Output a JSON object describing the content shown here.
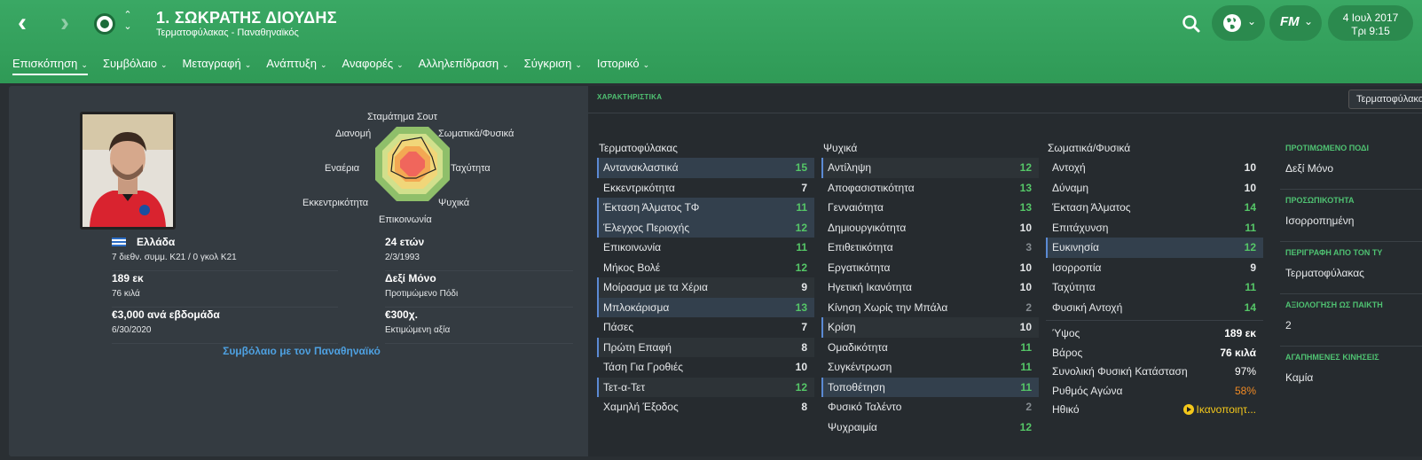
{
  "header": {
    "title": "1. ΣΩΚΡΑΤΗΣ ΔΙΟΥΔΗΣ",
    "subtitle": "Τερματοφύλακας - Παναθηναϊκός",
    "fm_label": "FM",
    "date": "4 Ιουλ 2017",
    "day_time": "Τρι 9:15",
    "back_icon": "chevron-left-icon",
    "forward_icon": "chevron-right-icon",
    "search_icon": "search-icon",
    "globe_icon": "globe-icon"
  },
  "tabs": [
    {
      "label": "Επισκόπηση",
      "active": true
    },
    {
      "label": "Συμβόλαιο"
    },
    {
      "label": "Μεταγραφή"
    },
    {
      "label": "Ανάπτυξη"
    },
    {
      "label": "Αναφορές"
    },
    {
      "label": "Αλληλεπίδραση"
    },
    {
      "label": "Σύγκριση"
    },
    {
      "label": "Ιστορικό"
    }
  ],
  "overview": {
    "radar_labels": {
      "top": "Σταμάτημα Σουτ",
      "top_left": "Διανομή",
      "top_right": "Σωματικά/Φυσικά",
      "left": "Εναέρια",
      "right": "Ταχύτητα",
      "bottom_left": "Εκκεντρικότητα",
      "bottom_right": "Ψυχικά",
      "bottom": "Επικοινωνία"
    },
    "nationality": "Ελλάδα",
    "caps": "7 διεθν. συμμ. K21 / 0 γκολ K21",
    "age": "24 ετών",
    "dob": "2/3/1993",
    "height": "189 εκ",
    "weight": "76 κιλά",
    "foot": "Δεξί Μόνο",
    "foot_label": "Προτιμώμενο Πόδι",
    "wage": "€3,000 ανά εβδομάδα",
    "contract_end": "6/30/2020",
    "value": "€300χ.",
    "value_label": "Εκτιμώμενη αξία",
    "contract_link": "Συμβόλαιο με τον Παναθηναϊκό"
  },
  "attributes": {
    "section_label": "ΧΑΡΑΚΤΗΡΙΣΤΙΚΑ",
    "role_button": "Τερματοφύλακας",
    "gk": {
      "title": "Τερματοφύλακας",
      "rows": [
        {
          "name": "Αντανακλαστικά",
          "value": "15"
        },
        {
          "name": "Εκκεντρικότητα",
          "value": "7"
        },
        {
          "name": "Έκταση Άλματος ΤΦ",
          "value": "11"
        },
        {
          "name": "Έλεγχος Περιοχής",
          "value": "12"
        },
        {
          "name": "Επικοινωνία",
          "value": "11"
        },
        {
          "name": "Μήκος Βολέ",
          "value": "12"
        },
        {
          "name": "Μοίρασμα με τα Χέρια",
          "value": "9"
        },
        {
          "name": "Μπλοκάρισμα",
          "value": "13"
        },
        {
          "name": "Πάσες",
          "value": "7"
        },
        {
          "name": "Πρώτη Επαφή",
          "value": "8"
        },
        {
          "name": "Τάση Για Γροθιές",
          "value": "10"
        },
        {
          "name": "Τετ-α-Τετ",
          "value": "12"
        },
        {
          "name": "Χαμηλή Έξοδος",
          "value": "8"
        }
      ]
    },
    "mental": {
      "title": "Ψυχικά",
      "rows": [
        {
          "name": "Αντίληψη",
          "value": "12"
        },
        {
          "name": "Αποφασιστικότητα",
          "value": "13"
        },
        {
          "name": "Γενναιότητα",
          "value": "13"
        },
        {
          "name": "Δημιουργικότητα",
          "value": "10"
        },
        {
          "name": "Επιθετικότητα",
          "value": "3"
        },
        {
          "name": "Εργατικότητα",
          "value": "10"
        },
        {
          "name": "Ηγετική Ικανότητα",
          "value": "10"
        },
        {
          "name": "Κίνηση Χωρίς την Μπάλα",
          "value": "2"
        },
        {
          "name": "Κρίση",
          "value": "10"
        },
        {
          "name": "Ομαδικότητα",
          "value": "11"
        },
        {
          "name": "Συγκέντρωση",
          "value": "11"
        },
        {
          "name": "Τοποθέτηση",
          "value": "11"
        },
        {
          "name": "Φυσικό Ταλέντο",
          "value": "2"
        },
        {
          "name": "Ψυχραιμία",
          "value": "12"
        }
      ]
    },
    "physical": {
      "title": "Σωματικά/Φυσικά",
      "rows": [
        {
          "name": "Αντοχή",
          "value": "10"
        },
        {
          "name": "Δύναμη",
          "value": "10"
        },
        {
          "name": "Έκταση Άλματος",
          "value": "14"
        },
        {
          "name": "Επιτάχυνση",
          "value": "11"
        },
        {
          "name": "Ευκινησία",
          "value": "12"
        },
        {
          "name": "Ισορροπία",
          "value": "9"
        },
        {
          "name": "Ταχύτητα",
          "value": "11"
        },
        {
          "name": "Φυσική Αντοχή",
          "value": "14"
        }
      ],
      "info": [
        {
          "name": "Ύψος",
          "value": "189 εκ"
        },
        {
          "name": "Βάρος",
          "value": "76 κιλά"
        },
        {
          "name": "Συνολική Φυσική Κατάσταση",
          "value": "97%"
        },
        {
          "name": "Ρυθμός Αγώνα",
          "value": "58%"
        },
        {
          "name": "Ηθικό",
          "value": "Ικανοποιητ..."
        }
      ]
    },
    "side": [
      {
        "heading": "ΠΡΟΤΙΜΩΜΕΝΟ ΠΟΔΙ",
        "value": "Δεξί Μόνο"
      },
      {
        "heading": "ΠΡΟΣΩΠΙΚΟΤΗΤΑ",
        "value": "Ισορροπημένη"
      },
      {
        "heading": "ΠΕΡΙΓΡΑΦΗ ΑΠΟ ΤΟΝ ΤΥ",
        "value": "Τερματοφύλακας"
      },
      {
        "heading": "ΑΞΙΟΛΟΓΗΣΗ ΩΣ ΠΑΙΚΤΗ",
        "value": "2"
      },
      {
        "heading": "ΑΓΑΠΗΜΕΝΕΣ ΚΙΝΗΣΕΙΣ",
        "value": "Καμία"
      }
    ]
  },
  "colors": {
    "header_green": "#34a35d",
    "attr_green": "#55c767",
    "attr_white": "#e6e8ea",
    "attr_grey": "#858b90",
    "match_fitness_orange": "#f08a24",
    "morale_yellow": "#f4c81b",
    "link_blue": "#4ea0e0"
  }
}
